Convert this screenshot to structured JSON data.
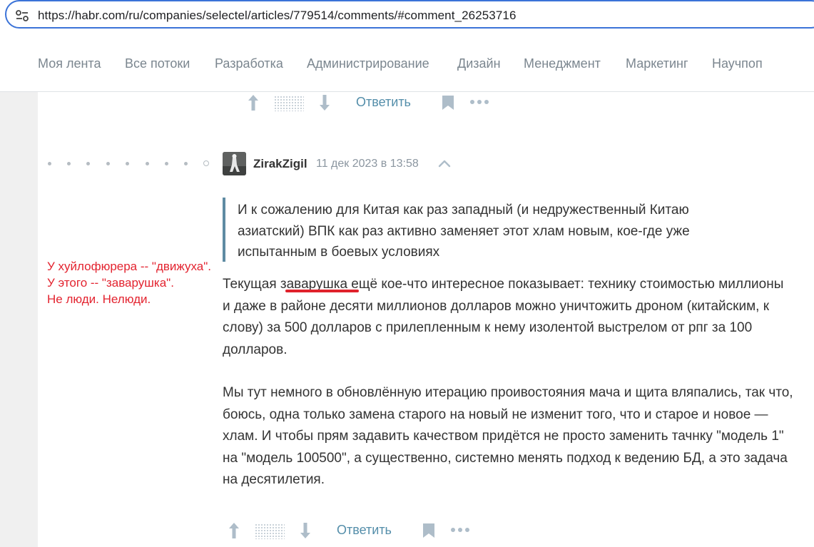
{
  "browser": {
    "url": "https://habr.com/ru/companies/selectel/articles/779514/comments/#comment_26253716"
  },
  "nav": {
    "items": [
      "Моя лента",
      "Все потоки",
      "Разработка",
      "Администрирование",
      "Дизайн",
      "Менеджмент",
      "Маркетинг",
      "Научпоп"
    ]
  },
  "actions": {
    "reply_label": "Ответить"
  },
  "comment": {
    "author": "ZirakZigil",
    "timestamp": "11 дек 2023 в 13:58",
    "quote": "И к сожалению для Китая как раз западный (и недружественный Китаю азиатский) ВПК как раз активно заменяет этот хлам новым, кое-где уже испытанным в боевых условиях",
    "p1_before": "Текущая ",
    "p1_highlight": "заварушка",
    "p1_after": " ещё кое-что интересное показывает: технику стоимостью миллионы и даже в районе десяти миллионов долларов можно уничтожить дроном (китайским, к слову) за 500 долларов с прилепленным к нему изолентой выстрелом от рпг за 100 долларов.",
    "p2": "Мы тут немного в обновлённую итерацию проивостояния мача и щита вляпались, так что, боюсь, одна только замена старого на новый не изменит того, что и старое и новое — хлам. И чтобы прям задавить качеством придётся не просто заменить тачнку \"модель 1\" на \"модель 100500\", а существенно, системно менять подход к ведению БД, а это задача на десятилетия."
  },
  "annotation": {
    "lines": [
      "У хуйлофюрера -- \"движуха\".",
      "У этого -- \"заварушка\".",
      "Не люди. Нелюди."
    ]
  },
  "colors": {
    "accent": "#3b73d8",
    "reply": "#548eaa",
    "annotation": "#e3232f",
    "quote_bar": "#5e8ba3"
  }
}
